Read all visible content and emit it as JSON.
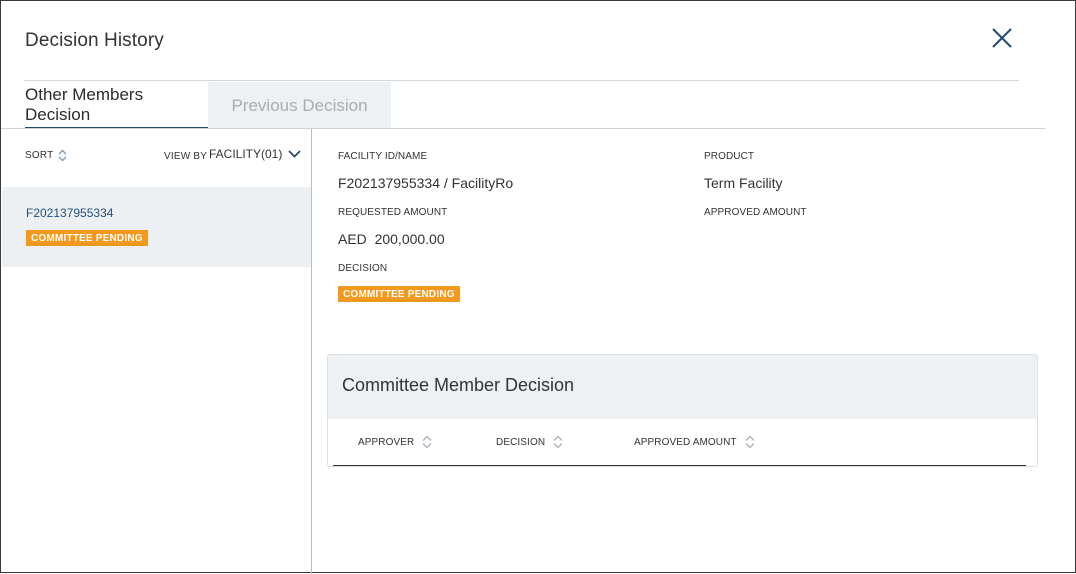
{
  "modal": {
    "title": "Decision History"
  },
  "tabs": [
    {
      "label": "Other Members Decision",
      "active": true
    },
    {
      "label": "Previous Decision",
      "active": false
    }
  ],
  "left_panel": {
    "sort_label": "SORT",
    "view_by_label": "VIEW BY",
    "view_by_value": "FACILITY(01)",
    "facilities": [
      {
        "id": "F202137955334",
        "status": "COMMITTEE PENDING"
      }
    ]
  },
  "details": {
    "facility_label": "FACILITY ID/NAME",
    "facility_value": "F202137955334 / FacilityRo",
    "product_label": "PRODUCT",
    "product_value": "Term Facility",
    "requested_label": "REQUESTED AMOUNT",
    "requested_value": "AED  200,000.00",
    "approved_label": "APPROVED AMOUNT",
    "decision_label": "DECISION",
    "decision_value": "COMMITTEE PENDING"
  },
  "committee": {
    "title": "Committee Member Decision",
    "columns": [
      "APPROVER",
      "DECISION",
      "APPROVED AMOUNT"
    ]
  },
  "colors": {
    "accent": "#234a70",
    "badge": "#f39a1e",
    "link": "#1f4f7a",
    "panel_bg": "#eef1f4"
  }
}
